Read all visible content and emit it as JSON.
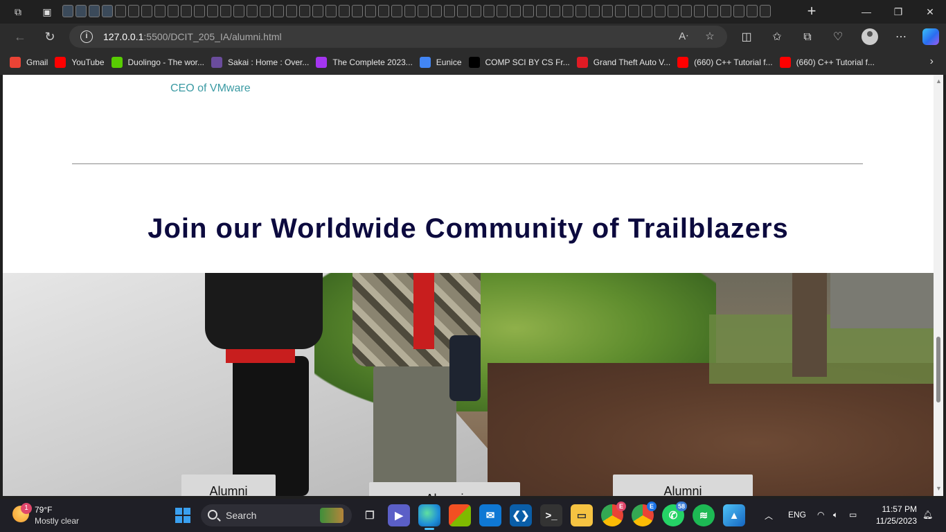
{
  "browser": {
    "url_host": "127.0.0.1",
    "url_path": ":5500/DCIT_205_IA/alumni.html",
    "bookmarks": [
      {
        "label": "Gmail",
        "icon": "google-icon",
        "color": "#ea4335"
      },
      {
        "label": "YouTube",
        "icon": "youtube-icon",
        "color": "#ff0000"
      },
      {
        "label": "Duolingo - The wor...",
        "icon": "duolingo-icon",
        "color": "#58cc02"
      },
      {
        "label": "Sakai : Home : Over...",
        "icon": "sakai-icon",
        "color": "#6a4c9c"
      },
      {
        "label": "The Complete 2023...",
        "icon": "udemy-icon",
        "color": "#a435f0"
      },
      {
        "label": "Eunice",
        "icon": "chrome-icon",
        "color": "#4285f4"
      },
      {
        "label": "COMP SCI BY CS Fr...",
        "icon": "cs-icon",
        "color": "#000000"
      },
      {
        "label": "Grand Theft Auto V...",
        "icon": "gta-icon",
        "color": "#e01b24"
      },
      {
        "label": "(660) C++ Tutorial f...",
        "icon": "youtube-icon",
        "color": "#ff0000"
      },
      {
        "label": "(660) C++ Tutorial f...",
        "icon": "youtube-icon",
        "color": "#ff0000"
      }
    ]
  },
  "page": {
    "ceo_role": "CEO of VMware",
    "headline": "Join our Worldwide Community of Trailblazers",
    "cards": [
      "Alumni",
      "Alumni",
      "Alumni"
    ]
  },
  "taskbar": {
    "weather_temp": "79°F",
    "weather_condition": "Mostly clear",
    "weather_badge": "1",
    "search_label": "Search",
    "language": "ENG",
    "time": "11:57 PM",
    "date": "11/25/2023",
    "whatsapp_badge": "58",
    "chrome_badge_1": "E",
    "chrome_badge_2": "E"
  }
}
